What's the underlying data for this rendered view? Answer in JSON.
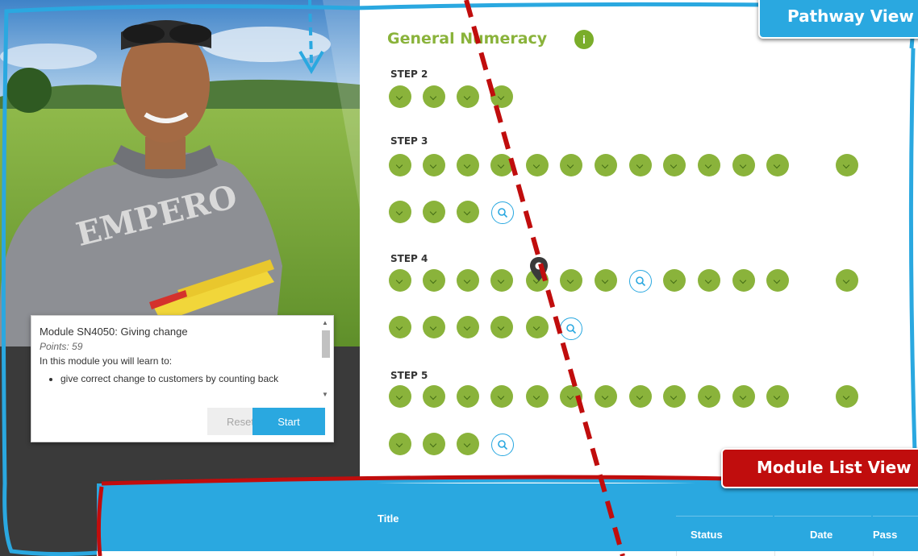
{
  "pathway": {
    "title": "General Numeracy",
    "info": "i",
    "steps": [
      {
        "label": "STEP 2"
      },
      {
        "label": "STEP 3"
      },
      {
        "label": "STEP 4"
      },
      {
        "label": "STEP 5"
      }
    ]
  },
  "module": {
    "title": "Module SN4050: Giving change",
    "points": "Points: 59",
    "intro": "In this module you will learn to:",
    "bullets": [
      "give correct change to customers by counting back"
    ],
    "reset_label": "Reset",
    "start_label": "Start"
  },
  "table": {
    "columns": {
      "title": "Title",
      "status": "Status",
      "date": "Date",
      "pass": "Pass"
    }
  },
  "callouts": {
    "pathway": "Pathway View",
    "module_list": "Module List View"
  },
  "colors": {
    "accent_blue": "#2aa8e0",
    "numeracy_green": "#8ab33b",
    "callout_red": "#c00d0d"
  }
}
